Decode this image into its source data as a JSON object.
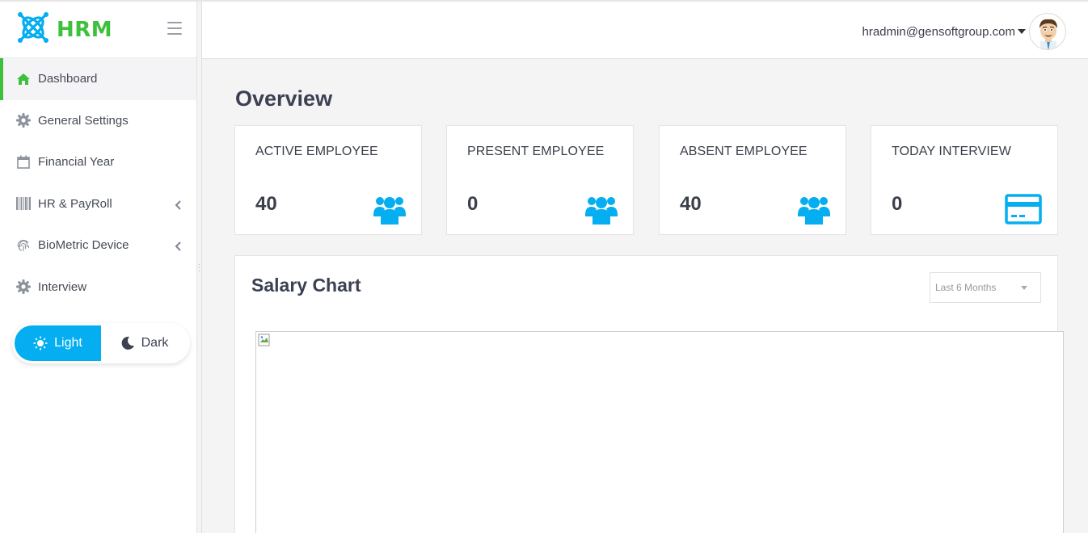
{
  "brand": {
    "logo_text": "HRM",
    "accent": "#3dc13c",
    "primary": "#04aef0"
  },
  "sidebar": {
    "items": [
      {
        "label": "Dashboard",
        "icon": "home-icon",
        "active": true
      },
      {
        "label": "General Settings",
        "icon": "gear-icon"
      },
      {
        "label": "Financial Year",
        "icon": "calendar-icon"
      },
      {
        "label": "HR & PayRoll",
        "icon": "barcode-icon",
        "has_submenu": true
      },
      {
        "label": "BioMetric Device",
        "icon": "fingerprint-icon",
        "has_submenu": true
      },
      {
        "label": "Interview",
        "icon": "gear-icon"
      }
    ],
    "theme": {
      "light_label": "Light",
      "dark_label": "Dark",
      "selected": "Light"
    }
  },
  "header": {
    "user_email": "hradmin@gensoftgroup.com",
    "avatar_icon": "cartoon-avatar-icon"
  },
  "main": {
    "title": "Overview",
    "cards": [
      {
        "title": "ACTIVE EMPLOYEE",
        "value": "40",
        "icon": "users-icon"
      },
      {
        "title": "PRESENT EMPLOYEE",
        "value": "0",
        "icon": "users-icon"
      },
      {
        "title": "ABSENT EMPLOYEE",
        "value": "40",
        "icon": "users-icon"
      },
      {
        "title": "TODAY INTERVIEW",
        "value": "0",
        "icon": "credit-card-icon"
      }
    ],
    "salary_chart": {
      "title": "Salary Chart",
      "period_selected": "Last 6 Months",
      "image_icon": "broken-image-icon"
    }
  }
}
